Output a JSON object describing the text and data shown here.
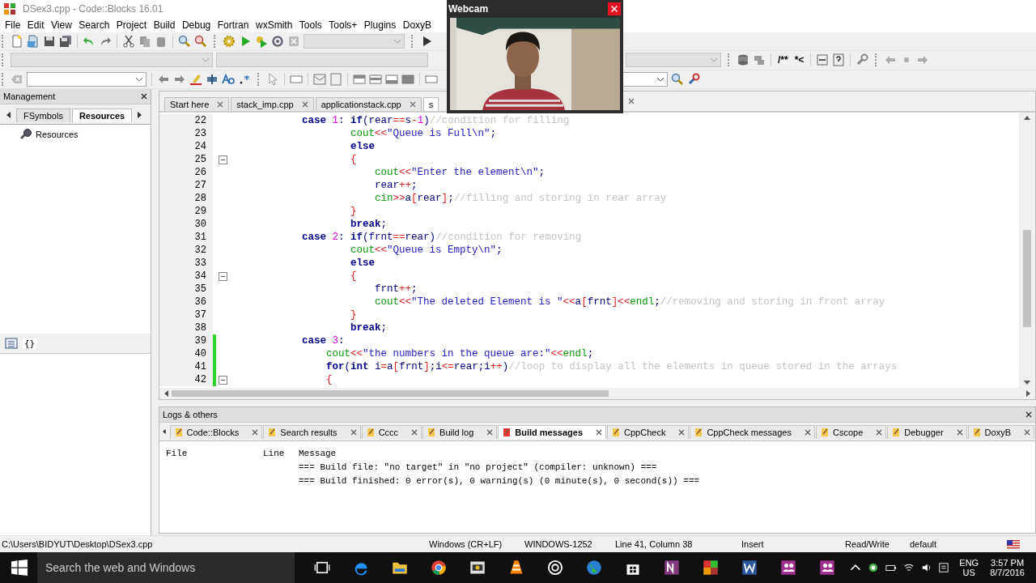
{
  "window": {
    "title": "DSex3.cpp - Code::Blocks 16.01"
  },
  "menu": [
    "File",
    "Edit",
    "View",
    "Search",
    "Project",
    "Build",
    "Debug",
    "Fortran",
    "wxSmith",
    "Tools",
    "Tools+",
    "Plugins",
    "DoxyB"
  ],
  "toolbar": {
    "doxy_buttons": [
      "/**",
      "*<"
    ]
  },
  "webcam": {
    "title": "Webcam"
  },
  "management": {
    "title": "Management",
    "tabs": [
      {
        "label": "FSymbols",
        "selected": false
      },
      {
        "label": "Resources",
        "selected": true
      }
    ],
    "tree": [
      {
        "label": "Resources"
      }
    ],
    "symbol_button": "{}"
  },
  "editor": {
    "tabs": [
      {
        "label": "Start here",
        "selected": false
      },
      {
        "label": "stack_imp.cpp",
        "selected": false
      },
      {
        "label": "applicationstack.cpp",
        "selected": false
      },
      {
        "label": "s",
        "selected": true
      }
    ],
    "lines": [
      {
        "number": "22",
        "fold": false,
        "modified": false,
        "tokens": [
          {
            "text": "            case ",
            "kind": "k"
          },
          {
            "text": "1",
            "kind": "n"
          },
          {
            "text": ": ",
            "kind": "p"
          },
          {
            "text": "if",
            "kind": "k"
          },
          {
            "text": "(rear",
            "kind": "p"
          },
          {
            "text": "==",
            "kind": "o"
          },
          {
            "text": "s",
            "kind": "p"
          },
          {
            "text": "-",
            "kind": "o"
          },
          {
            "text": "1",
            "kind": "n"
          },
          {
            "text": ")",
            "kind": "p"
          },
          {
            "text": "//condition for filling",
            "kind": "c"
          }
        ]
      },
      {
        "number": "23",
        "fold": false,
        "modified": false,
        "tokens": [
          {
            "text": "                    cout",
            "kind": "f"
          },
          {
            "text": "<<",
            "kind": "o"
          },
          {
            "text": "\"Queue is Full\\n\"",
            "kind": "s"
          },
          {
            "text": ";",
            "kind": "p"
          }
        ]
      },
      {
        "number": "24",
        "fold": false,
        "modified": false,
        "tokens": [
          {
            "text": "                    else",
            "kind": "k"
          }
        ]
      },
      {
        "number": "25",
        "fold": true,
        "modified": false,
        "tokens": [
          {
            "text": "                    {",
            "kind": "o"
          }
        ]
      },
      {
        "number": "26",
        "fold": false,
        "modified": false,
        "tokens": [
          {
            "text": "                        cout",
            "kind": "f"
          },
          {
            "text": "<<",
            "kind": "o"
          },
          {
            "text": "\"Enter the element\\n\"",
            "kind": "s"
          },
          {
            "text": ";",
            "kind": "p"
          }
        ]
      },
      {
        "number": "27",
        "fold": false,
        "modified": false,
        "tokens": [
          {
            "text": "                        rear",
            "kind": "p"
          },
          {
            "text": "++",
            "kind": "o"
          },
          {
            "text": ";",
            "kind": "p"
          }
        ]
      },
      {
        "number": "28",
        "fold": false,
        "modified": false,
        "tokens": [
          {
            "text": "                        cin",
            "kind": "f"
          },
          {
            "text": ">>",
            "kind": "o"
          },
          {
            "text": "a",
            "kind": "p"
          },
          {
            "text": "[",
            "kind": "o"
          },
          {
            "text": "rear",
            "kind": "p"
          },
          {
            "text": "]",
            "kind": "o"
          },
          {
            "text": ";",
            "kind": "p"
          },
          {
            "text": "//filling and storing in rear array",
            "kind": "c"
          }
        ]
      },
      {
        "number": "29",
        "fold": false,
        "modified": false,
        "tokens": [
          {
            "text": "                    }",
            "kind": "o"
          }
        ]
      },
      {
        "number": "30",
        "fold": false,
        "modified": false,
        "tokens": [
          {
            "text": "                    break",
            "kind": "k"
          },
          {
            "text": ";",
            "kind": "p"
          }
        ]
      },
      {
        "number": "31",
        "fold": false,
        "modified": false,
        "tokens": [
          {
            "text": "            case ",
            "kind": "k"
          },
          {
            "text": "2",
            "kind": "n"
          },
          {
            "text": ": ",
            "kind": "p"
          },
          {
            "text": "if",
            "kind": "k"
          },
          {
            "text": "(frnt",
            "kind": "p"
          },
          {
            "text": "==",
            "kind": "o"
          },
          {
            "text": "rear)",
            "kind": "p"
          },
          {
            "text": "//condition for removing",
            "kind": "c"
          }
        ]
      },
      {
        "number": "32",
        "fold": false,
        "modified": false,
        "tokens": [
          {
            "text": "                    cout",
            "kind": "f"
          },
          {
            "text": "<<",
            "kind": "o"
          },
          {
            "text": "\"Queue is Empty\\n\"",
            "kind": "s"
          },
          {
            "text": ";",
            "kind": "p"
          }
        ]
      },
      {
        "number": "33",
        "fold": false,
        "modified": false,
        "tokens": [
          {
            "text": "                    else",
            "kind": "k"
          }
        ]
      },
      {
        "number": "34",
        "fold": true,
        "modified": false,
        "tokens": [
          {
            "text": "                    {",
            "kind": "o"
          }
        ]
      },
      {
        "number": "35",
        "fold": false,
        "modified": false,
        "tokens": [
          {
            "text": "                        frnt",
            "kind": "p"
          },
          {
            "text": "++",
            "kind": "o"
          },
          {
            "text": ";",
            "kind": "p"
          }
        ]
      },
      {
        "number": "36",
        "fold": false,
        "modified": false,
        "tokens": [
          {
            "text": "                        cout",
            "kind": "f"
          },
          {
            "text": "<<",
            "kind": "o"
          },
          {
            "text": "\"The deleted Element is \"",
            "kind": "s"
          },
          {
            "text": "<<",
            "kind": "o"
          },
          {
            "text": "a",
            "kind": "p"
          },
          {
            "text": "[",
            "kind": "o"
          },
          {
            "text": "frnt",
            "kind": "p"
          },
          {
            "text": "]",
            "kind": "o"
          },
          {
            "text": "<<",
            "kind": "o"
          },
          {
            "text": "endl",
            "kind": "f"
          },
          {
            "text": ";",
            "kind": "p"
          },
          {
            "text": "//removing and storing in front array",
            "kind": "c"
          }
        ]
      },
      {
        "number": "37",
        "fold": false,
        "modified": false,
        "tokens": [
          {
            "text": "                    }",
            "kind": "o"
          }
        ]
      },
      {
        "number": "38",
        "fold": false,
        "modified": false,
        "tokens": [
          {
            "text": "                    break",
            "kind": "k"
          },
          {
            "text": ";",
            "kind": "p"
          }
        ]
      },
      {
        "number": "39",
        "fold": false,
        "modified": true,
        "tokens": [
          {
            "text": "            case ",
            "kind": "k"
          },
          {
            "text": "3",
            "kind": "n"
          },
          {
            "text": ":",
            "kind": "p"
          }
        ]
      },
      {
        "number": "40",
        "fold": false,
        "modified": true,
        "tokens": [
          {
            "text": "                cout",
            "kind": "f"
          },
          {
            "text": "<<",
            "kind": "o"
          },
          {
            "text": "\"the numbers in the queue are:\"",
            "kind": "s"
          },
          {
            "text": "<<",
            "kind": "o"
          },
          {
            "text": "endl",
            "kind": "f"
          },
          {
            "text": ";",
            "kind": "p"
          }
        ]
      },
      {
        "number": "41",
        "fold": false,
        "modified": true,
        "tokens": [
          {
            "text": "                for",
            "kind": "k"
          },
          {
            "text": "(",
            "kind": "p"
          },
          {
            "text": "int",
            "kind": "k"
          },
          {
            "text": " i",
            "kind": "p"
          },
          {
            "text": "=",
            "kind": "o"
          },
          {
            "text": "a",
            "kind": "p"
          },
          {
            "text": "[",
            "kind": "o"
          },
          {
            "text": "frnt",
            "kind": "p"
          },
          {
            "text": "]",
            "kind": "o"
          },
          {
            "text": ";i",
            "kind": "p"
          },
          {
            "text": "<=",
            "kind": "o"
          },
          {
            "text": "rear;i",
            "kind": "p"
          },
          {
            "text": "++",
            "kind": "o"
          },
          {
            "text": ")",
            "kind": "p"
          },
          {
            "text": "//loop to display all the elements in queue stored in the arrays",
            "kind": "c"
          }
        ]
      },
      {
        "number": "42",
        "fold": true,
        "modified": true,
        "tokens": [
          {
            "text": "                {",
            "kind": "o"
          }
        ]
      }
    ]
  },
  "logs": {
    "title": "Logs & others",
    "tabs": [
      {
        "label": "Code::Blocks",
        "selected": false
      },
      {
        "label": "Search results",
        "selected": false
      },
      {
        "label": "Cccc",
        "selected": false
      },
      {
        "label": "Build log",
        "selected": false
      },
      {
        "label": "Build messages",
        "selected": true
      },
      {
        "label": "CppCheck",
        "selected": false
      },
      {
        "label": "CppCheck messages",
        "selected": false
      },
      {
        "label": "Cscope",
        "selected": false
      },
      {
        "label": "Debugger",
        "selected": false
      },
      {
        "label": "DoxyB",
        "selected": false
      }
    ],
    "columns": [
      "File",
      "Line",
      "Message"
    ],
    "messages": [
      "=== Build file: \"no target\" in \"no project\" (compiler: unknown) ===",
      "=== Build finished: 0 error(s), 0 warning(s) (0 minute(s), 0 second(s)) ==="
    ]
  },
  "status_bar": {
    "path": "C:\\Users\\BIDYUT\\Desktop\\DSex3.cpp",
    "fields": [
      "Windows (CR+LF)",
      "WINDOWS-1252",
      "Line 41, Column 38",
      "Insert",
      "Read/Write",
      "default"
    ]
  },
  "taskbar": {
    "search_placeholder": "Search the web and Windows",
    "language": [
      "ENG",
      "US"
    ],
    "time": "3:57 PM",
    "date": "8/7/2016"
  }
}
